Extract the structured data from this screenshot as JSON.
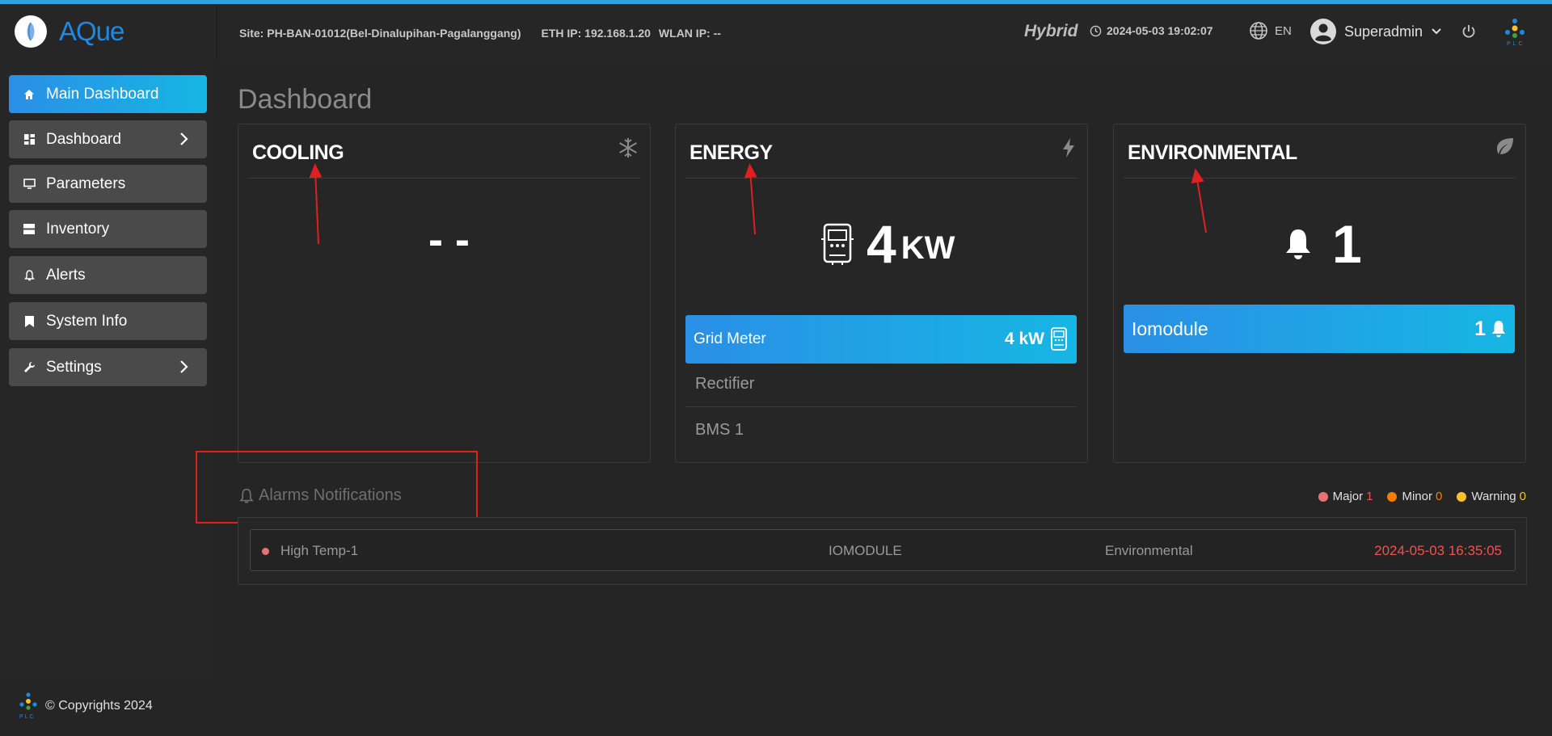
{
  "brand": {
    "name": "AQue",
    "logo_caption": "PLC"
  },
  "header": {
    "site": "Site: PH-BAN-01012(Bel-Dinalupihan-Pagalanggang)",
    "eth_ip": "ETH IP: 192.168.1.20",
    "wlan_ip": "WLAN IP: --",
    "mode": "Hybrid",
    "datetime": "2024-05-03 19:02:07",
    "language": "EN",
    "user": "Superadmin"
  },
  "sidebar": {
    "items": [
      {
        "label": "Main Dashboard",
        "icon": "home-icon",
        "active": true
      },
      {
        "label": "Dashboard",
        "icon": "grid-icon",
        "has_children": true
      },
      {
        "label": "Parameters",
        "icon": "monitor-icon"
      },
      {
        "label": "Inventory",
        "icon": "server-icon"
      },
      {
        "label": "Alerts",
        "icon": "bell-icon"
      },
      {
        "label": "System Info",
        "icon": "bookmark-icon"
      },
      {
        "label": "Settings",
        "icon": "wrench-icon",
        "has_children": true
      }
    ]
  },
  "footer": {
    "copyright": "© Copyrights 2024"
  },
  "main": {
    "title": "Dashboard",
    "cards": {
      "cooling": {
        "title": "COOLING",
        "value": "- -",
        "icon": "snowflake-icon"
      },
      "energy": {
        "title": "ENERGY",
        "value": "4",
        "unit": "KW",
        "icon": "bolt-icon",
        "rows": [
          {
            "label": "Grid Meter",
            "value": "4 kW",
            "active": true
          },
          {
            "label": "Rectifier"
          },
          {
            "label": "BMS 1"
          }
        ]
      },
      "environmental": {
        "title": "ENVIRONMENTAL",
        "value": "1",
        "icon": "leaf-icon",
        "rows": [
          {
            "label": "Iomodule",
            "value": "1",
            "active": true
          }
        ]
      }
    },
    "alarms": {
      "title": "Alarms Notifications",
      "legend": [
        {
          "label": "Major",
          "count": "1",
          "color": "#e57373"
        },
        {
          "label": "Minor",
          "count": "0",
          "color": "#f57c00"
        },
        {
          "label": "Warning",
          "count": "0",
          "color": "#fbc02d"
        }
      ],
      "rows": [
        {
          "name": "High Temp-1",
          "device": "IOMODULE",
          "category": "Environmental",
          "time": "2024-05-03 16:35:05"
        }
      ]
    }
  },
  "colors": {
    "accent": "#1e88e5",
    "active_gradient_end": "#16b6e4",
    "alarm_time": "#ef5350"
  }
}
